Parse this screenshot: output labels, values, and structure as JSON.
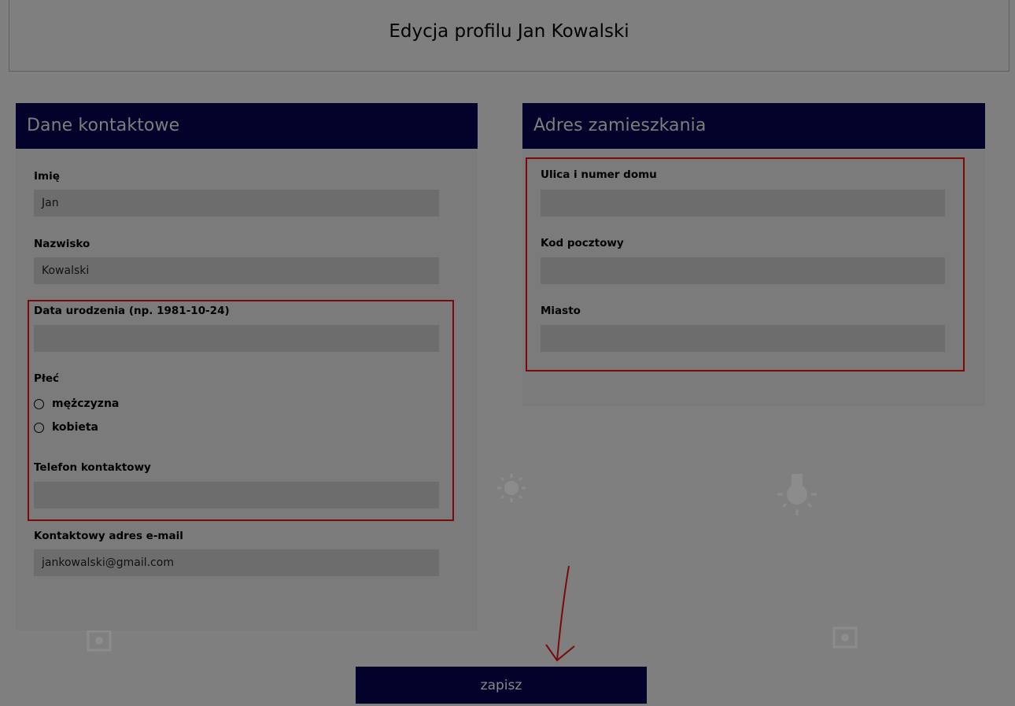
{
  "header": {
    "title": "Edycja profilu Jan Kowalski"
  },
  "contact": {
    "heading": "Dane kontaktowe",
    "first_name_label": "Imię",
    "first_name_value": "Jan",
    "last_name_label": "Nazwisko",
    "last_name_value": "Kowalski",
    "birthdate_label": "Data urodzenia (np. 1981-10-24)",
    "birthdate_value": "",
    "gender_label": "Płeć",
    "gender_options": [
      "mężczyzna",
      "kobieta"
    ],
    "phone_label": "Telefon kontaktowy",
    "phone_value": "",
    "email_label": "Kontaktowy adres e-mail",
    "email_value": "jankowalski@gmail.com"
  },
  "address": {
    "heading": "Adres zamieszkania",
    "street_label": "Ulica i numer domu",
    "street_value": "",
    "postcode_label": "Kod pocztowy",
    "postcode_value": "",
    "city_label": "Miasto",
    "city_value": ""
  },
  "actions": {
    "save_label": "zapisz"
  },
  "colors": {
    "overlay": "#7f7f7f",
    "header_bar": "#02022a",
    "highlight": "#7a0a0a"
  }
}
